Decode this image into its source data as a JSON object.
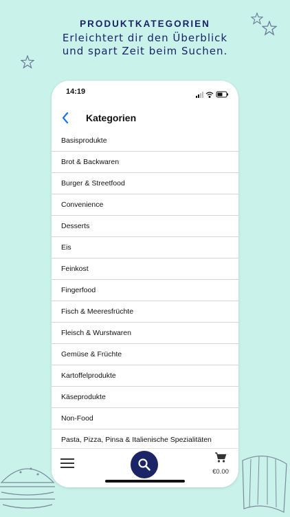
{
  "promo": {
    "title": "PRODUKTKATEGORIEN",
    "subtitle_line1": "Erleichtert dir den Überblick",
    "subtitle_line2": "und spart Zeit beim Suchen."
  },
  "status_bar": {
    "time": "14:19"
  },
  "nav": {
    "title": "Kategorien"
  },
  "categories": [
    "Basisprodukte",
    "Brot & Backwaren",
    "Burger & Streetfood",
    "Convenience",
    "Desserts",
    "Eis",
    "Feinkost",
    "Fingerfood",
    "Fisch & Meeresfrüchte",
    "Fleisch & Wurstwaren",
    "Gemüse & Früchte",
    "Kartoffelprodukte",
    "Käseprodukte",
    "Non-Food",
    "Pasta, Pizza, Pinsa & Italienische Spezialitäten"
  ],
  "tab_bar": {
    "cart_total": "€0.00"
  },
  "colors": {
    "background": "#c9f2ea",
    "brand_navy": "#1a2466",
    "accent_blue": "#1a73e8"
  },
  "icons": [
    "star-icon",
    "back-chevron-icon",
    "signal-icon",
    "wifi-icon",
    "battery-icon",
    "menu-icon",
    "search-icon",
    "cart-icon"
  ]
}
